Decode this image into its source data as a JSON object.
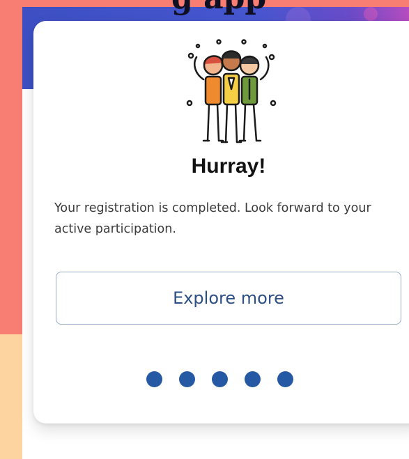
{
  "background": {
    "caption": "g app"
  },
  "card": {
    "title": "Hurray!",
    "message": "Your registration is completed. Look forward to your active participation.",
    "cta_label": "Explore more",
    "illustration_icon": "celebrating-friends-icon",
    "pagination": {
      "total": 5
    }
  },
  "colors": {
    "accent": "#2559a4",
    "button_text": "#2c4f86",
    "banner": "#3d4fc3",
    "left_strip_top": "#f87d73",
    "left_strip_bottom": "#fdd4a0"
  }
}
